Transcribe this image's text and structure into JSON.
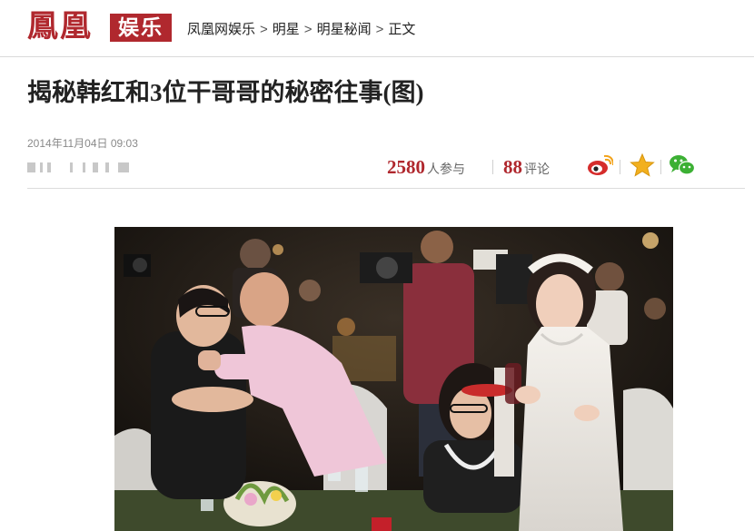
{
  "header": {
    "logo_text": "鳳凰",
    "logo_channel": "娱乐",
    "breadcrumb": [
      "凤凰网娱乐",
      "明星",
      "明星秘闻",
      "正文"
    ],
    "separator": ">"
  },
  "article": {
    "title": "揭秘韩红和3位干哥哥的秘密往事(图)",
    "date": "2014年11月04日 09:03",
    "stats": {
      "participants_count": "2580",
      "participants_label": "人参与",
      "comments_count": "88",
      "comments_label": "评论"
    }
  },
  "share_icons": [
    "weibo-icon",
    "star-icon",
    "wechat-icon"
  ],
  "colors": {
    "brand_red": "#b0282e",
    "weibo_red": "#d52c2b",
    "star_gold": "#f2b01e",
    "wechat_green": "#3cb034"
  }
}
